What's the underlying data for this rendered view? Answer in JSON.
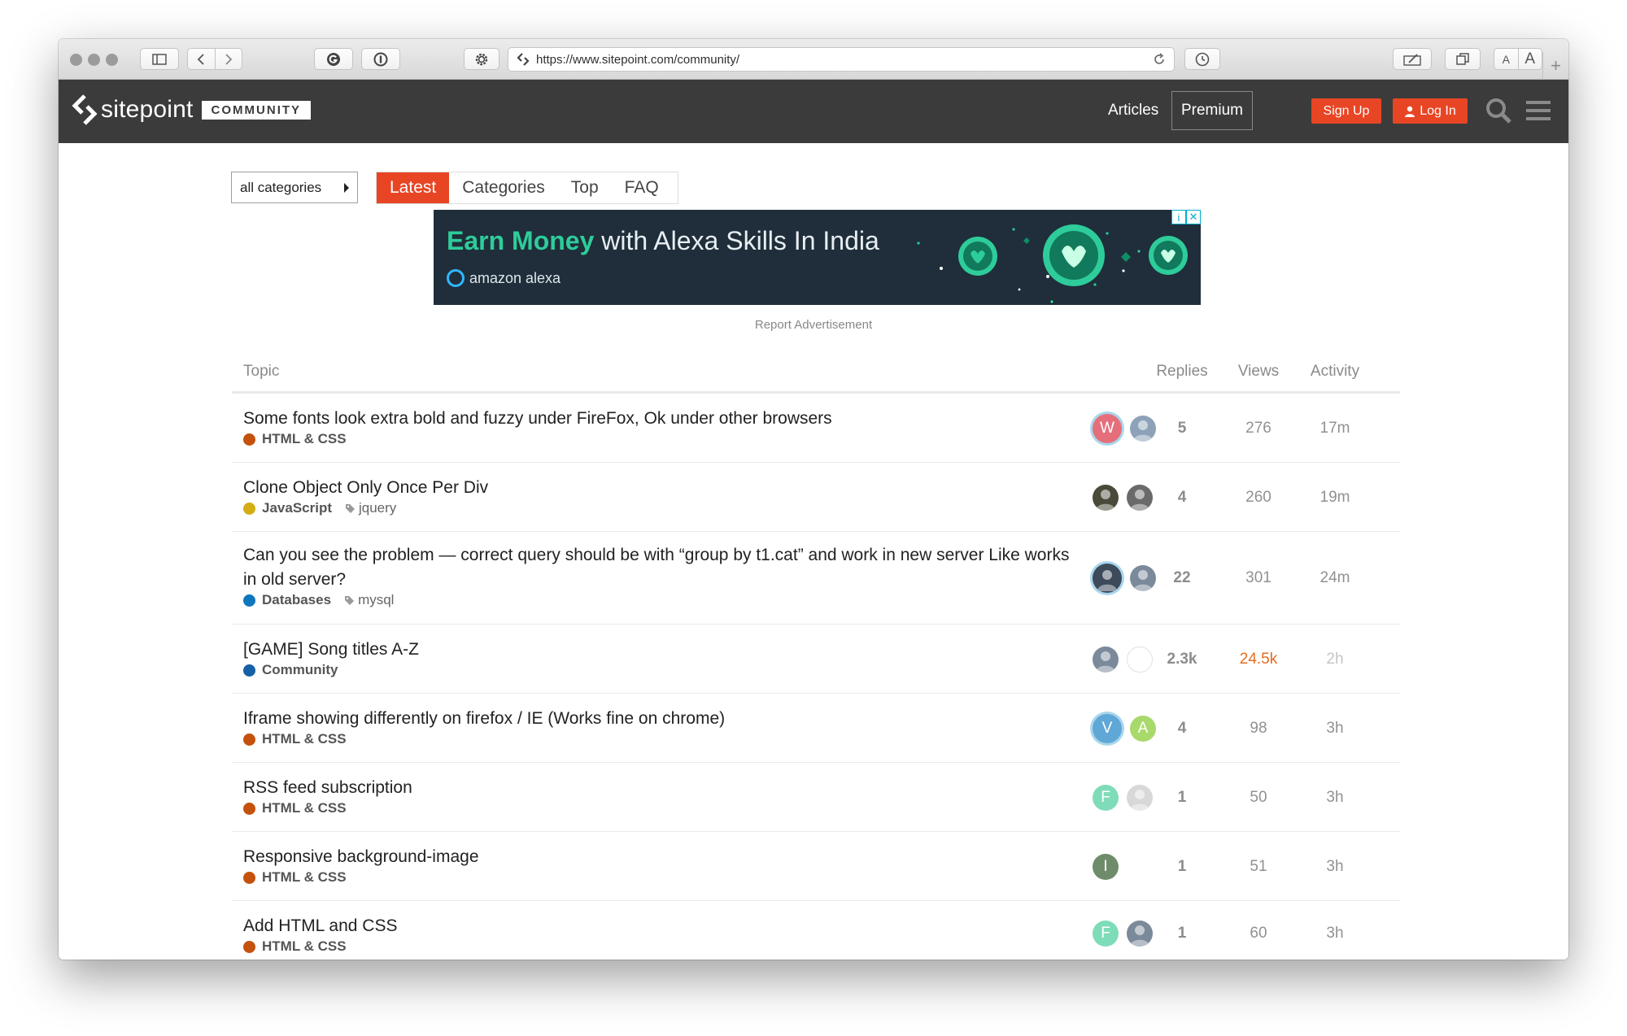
{
  "browser": {
    "url": "https://www.sitepoint.com/community/",
    "font_small_label": "A",
    "font_large_label": "A",
    "new_tab_label": "+"
  },
  "header": {
    "logo_text": "sitepoint",
    "community_label": "COMMUNITY",
    "articles_label": "Articles",
    "premium_label": "Premium",
    "signup_label": "Sign Up",
    "login_label": "Log In",
    "accent": "#e84524",
    "bg": "#3b3b3b"
  },
  "filters": {
    "category_dropdown": "all categories",
    "tabs": [
      "Latest",
      "Categories",
      "Top",
      "FAQ"
    ],
    "active_tab": "Latest"
  },
  "ad": {
    "headline_highlight": "Earn Money",
    "headline_rest": " with Alexa Skills In India",
    "brand": "amazon alexa",
    "report_label": "Report Advertisement",
    "info_glyph": "i",
    "close_glyph": "✕"
  },
  "table": {
    "headers": {
      "topic": "Topic",
      "replies": "Replies",
      "views": "Views",
      "activity": "Activity"
    },
    "rows": [
      {
        "title": "Some fonts look extra bold and fuzzy under FireFox, Ok under other browsers",
        "category": "HTML & CSS",
        "category_color": "#c4520c",
        "tag": "",
        "avatars": [
          {
            "letter": "W",
            "color": "#e46f7b",
            "poster": true
          },
          {
            "letter": "",
            "color": "#8da2b8",
            "poster": false
          }
        ],
        "replies": "5",
        "views": "276",
        "activity": "17m",
        "views_hot": false,
        "activity_faded": false
      },
      {
        "title": "Clone Object Only Once Per Div",
        "category": "JavaScript",
        "category_color": "#d4ac14",
        "tag": "jquery",
        "avatars": [
          {
            "letter": "",
            "color": "#4a4a3a",
            "poster": false
          },
          {
            "letter": "",
            "color": "#6a6a6a",
            "poster": false
          }
        ],
        "replies": "4",
        "views": "260",
        "activity": "19m",
        "views_hot": false,
        "activity_faded": false
      },
      {
        "title": "Can you see the problem — correct query should be with “group by t1.cat” and work in new server Like works in old server?",
        "category": "Databases",
        "category_color": "#0e76bd",
        "tag": "mysql",
        "avatars": [
          {
            "letter": "",
            "color": "#3c4a5a",
            "poster": true
          },
          {
            "letter": "",
            "color": "#7b8a9a",
            "poster": false
          }
        ],
        "replies": "22",
        "views": "301",
        "activity": "24m",
        "views_hot": false,
        "activity_faded": false
      },
      {
        "title": "[GAME] Song titles A-Z",
        "category": "Community",
        "category_color": "#1560a6",
        "tag": "",
        "avatars": [
          {
            "letter": "",
            "color": "#7b8a9a",
            "poster": false
          },
          {
            "letter": "",
            "color": "#ffffff",
            "poster": false
          }
        ],
        "replies": "2.3k",
        "views": "24.5k",
        "activity": "2h",
        "views_hot": true,
        "activity_faded": true
      },
      {
        "title": "Iframe showing differently on firefox / IE (Works fine on chrome)",
        "category": "HTML & CSS",
        "category_color": "#c4520c",
        "tag": "",
        "avatars": [
          {
            "letter": "V",
            "color": "#5fa7d6",
            "poster": true
          },
          {
            "letter": "A",
            "color": "#a8d96b",
            "poster": false
          }
        ],
        "replies": "4",
        "views": "98",
        "activity": "3h",
        "views_hot": false,
        "activity_faded": false
      },
      {
        "title": "RSS feed subscription",
        "category": "HTML & CSS",
        "category_color": "#c4520c",
        "tag": "",
        "avatars": [
          {
            "letter": "F",
            "color": "#7fdcb8",
            "poster": false
          },
          {
            "letter": "",
            "color": "#d8d8d8",
            "poster": false
          }
        ],
        "replies": "1",
        "views": "50",
        "activity": "3h",
        "views_hot": false,
        "activity_faded": false
      },
      {
        "title": "Responsive background-image",
        "category": "HTML & CSS",
        "category_color": "#c4520c",
        "tag": "",
        "avatars": [
          {
            "letter": "I",
            "color": "#6e8c6a",
            "poster": false
          }
        ],
        "replies": "1",
        "views": "51",
        "activity": "3h",
        "views_hot": false,
        "activity_faded": false
      },
      {
        "title": "Add HTML and CSS",
        "category": "HTML & CSS",
        "category_color": "#c4520c",
        "tag": "",
        "avatars": [
          {
            "letter": "F",
            "color": "#7fdcb8",
            "poster": false
          },
          {
            "letter": "",
            "color": "#7b8a9a",
            "poster": false
          }
        ],
        "replies": "1",
        "views": "60",
        "activity": "3h",
        "views_hot": false,
        "activity_faded": false
      }
    ]
  }
}
